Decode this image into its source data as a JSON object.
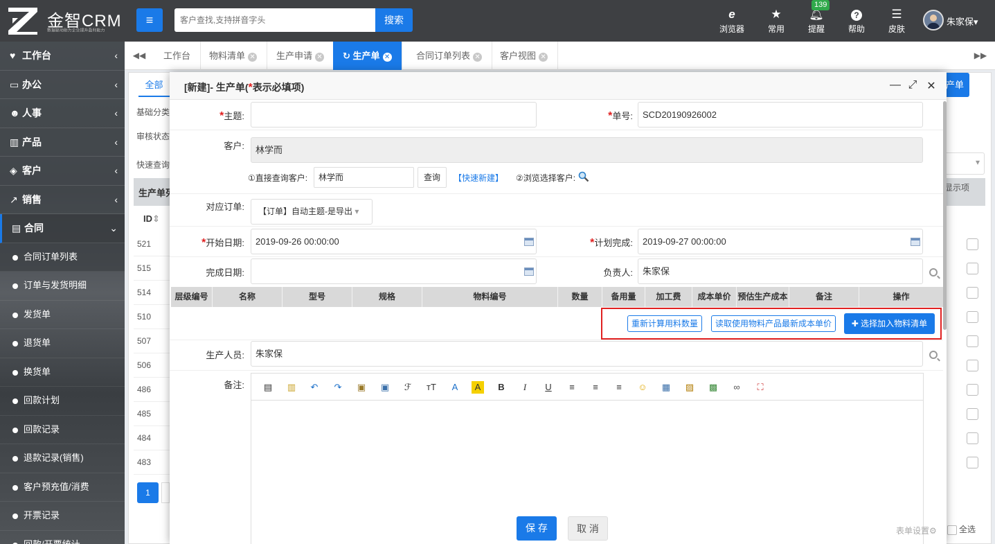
{
  "brand": {
    "name": "金智CRM",
    "tagline": "数据驱动助力企业提升盈利能力"
  },
  "topbar": {
    "search_placeholder": "客户查找,支持拼音字头",
    "search_button": "搜索",
    "tools": [
      {
        "label": "浏览器",
        "icon": "ie-browser-icon"
      },
      {
        "label": "常用",
        "icon": "star-icon"
      },
      {
        "label": "提醒",
        "icon": "bell-icon"
      },
      {
        "label": "帮助",
        "icon": "help-icon"
      },
      {
        "label": "皮肤",
        "icon": "skin-icon"
      }
    ],
    "reminder_count": "139",
    "user_name": "朱家保"
  },
  "sidebar": {
    "groups": [
      {
        "label": "工作台"
      },
      {
        "label": "办公"
      },
      {
        "label": "人事"
      },
      {
        "label": "产品"
      },
      {
        "label": "客户"
      },
      {
        "label": "销售"
      },
      {
        "label": "合同"
      }
    ],
    "sub_items": [
      "合同订单列表",
      "订单与发货明细",
      "发货单",
      "退货单",
      "换货单",
      "回款计划",
      "回款记录",
      "退款记录(销售)",
      "客户预充值/消费",
      "开票记录",
      "回款/开票统计"
    ]
  },
  "tabs": [
    "工作台",
    "物料清单",
    "生产申请",
    "生产单",
    "合同订单列表",
    "客户视图"
  ],
  "background": {
    "tab_all": "全部",
    "filter_labels": [
      "基础分类",
      "审核状态",
      "快速查询"
    ],
    "list_title": "生产单列",
    "id_header": "ID",
    "ids": [
      "521",
      "515",
      "514",
      "510",
      "507",
      "506",
      "486",
      "485",
      "484",
      "483"
    ],
    "right_button": "产单",
    "display_items": "显示项",
    "page": "1",
    "select_all": "全选"
  },
  "modal": {
    "title_prefix": "[新建]- 生产单(",
    "title_star": "*",
    "title_suffix": "表示必填项)",
    "fields": {
      "subject_label": "主题:",
      "subject_value": "",
      "number_label": "单号:",
      "number_value": "SCD20190926002",
      "customer_label": "客户:",
      "customer_value": "林学而",
      "direct_query_label": "①直接查询客户:",
      "direct_query_value": "林学而",
      "query_button": "查询",
      "quick_new": "【快速新建】",
      "browse_select": "②浏览选择客户:",
      "order_label": "对应订单:",
      "order_value": "【订单】自动主题-是导出",
      "start_label": "开始日期:",
      "start_value": "2019-09-26 00:00:00",
      "plan_label": "计划完成:",
      "plan_value": "2019-09-27 00:00:00",
      "finish_label": "完成日期:",
      "finish_value": "",
      "owner_label": "负责人:",
      "owner_value": "朱家保",
      "staff_label": "生产人员:",
      "staff_value": "朱家保",
      "remark_label": "备注:"
    },
    "grid_headers": [
      "层级编号",
      "名称",
      "型号",
      "规格",
      "物料编号",
      "数量",
      "备用量",
      "加工费",
      "成本单价",
      "预估生产成本",
      "备注",
      "操作"
    ],
    "grid_buttons": {
      "recalc": "重新计算用料数量",
      "read_cost": "读取使用物料产品最新成本单价",
      "select_bom": "✚ 选择加入物料清单"
    },
    "save": "保 存",
    "cancel": "取 消",
    "form_settings": "表单设置"
  },
  "colors": {
    "primary": "#1a7ae8",
    "required": "#e02020",
    "topbar": "#3e4043"
  }
}
